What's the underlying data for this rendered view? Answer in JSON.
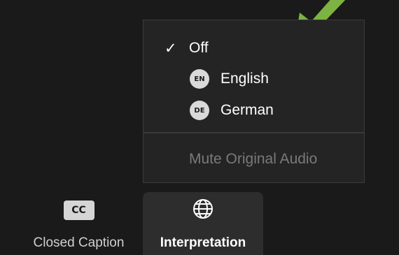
{
  "menu": {
    "items": [
      {
        "label": "Off",
        "checked": true,
        "check_glyph": "✓"
      },
      {
        "label": "English",
        "badge": "EN"
      },
      {
        "label": "German",
        "badge": "DE"
      }
    ],
    "mute_label": "Mute Original Audio"
  },
  "toolbar": {
    "cc_icon_text": "CC",
    "cc_label": "Closed Caption",
    "interp_label": "Interpretation"
  },
  "colors": {
    "background": "#1a1a1a",
    "menu_bg": "#242424",
    "arrow": "#7cb342"
  }
}
